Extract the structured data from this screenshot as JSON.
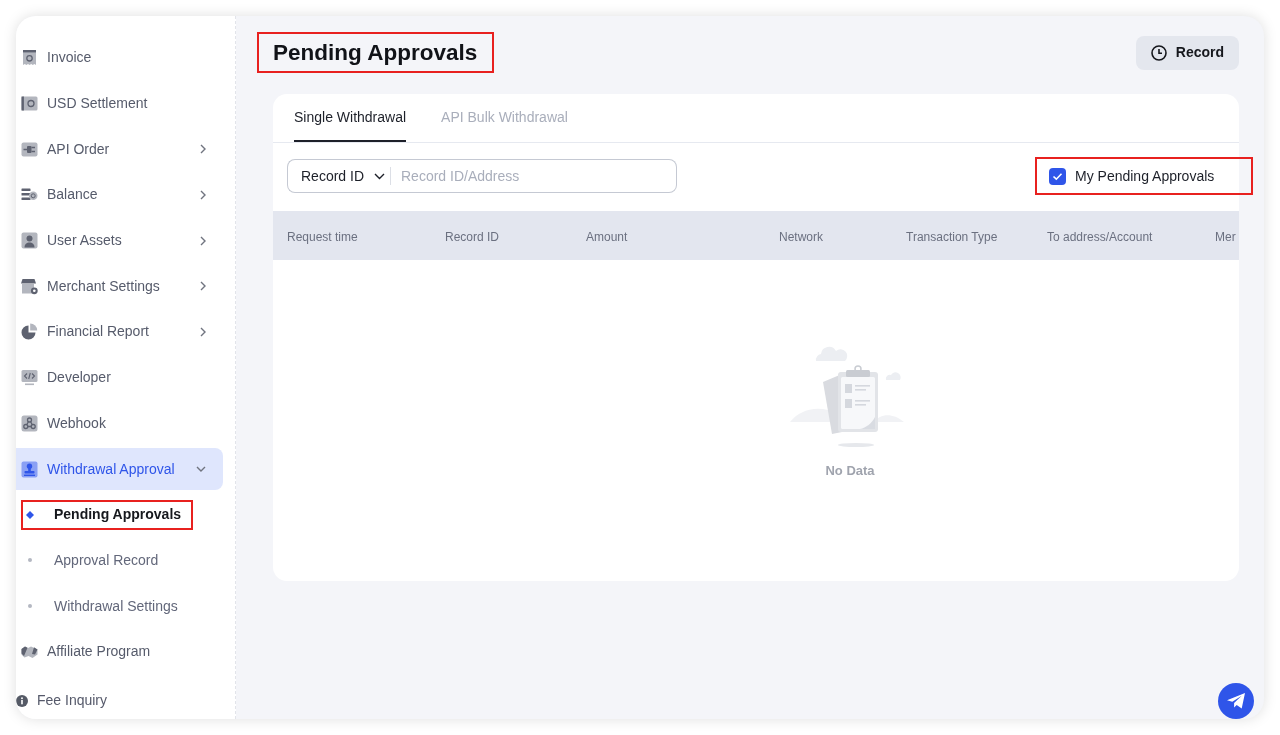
{
  "sidebar": {
    "items": [
      {
        "label": "Invoice",
        "kind": "link",
        "selected": false
      },
      {
        "label": "USD Settlement",
        "kind": "link",
        "selected": false
      },
      {
        "label": "API Order",
        "kind": "group",
        "expanded": false,
        "selected": false
      },
      {
        "label": "Balance",
        "kind": "group",
        "expanded": false,
        "selected": false
      },
      {
        "label": "User Assets",
        "kind": "group",
        "expanded": false,
        "selected": false
      },
      {
        "label": "Merchant Settings",
        "kind": "group",
        "expanded": false,
        "selected": false
      },
      {
        "label": "Financial Report",
        "kind": "group",
        "expanded": false,
        "selected": false
      },
      {
        "label": "Developer",
        "kind": "link",
        "selected": false
      },
      {
        "label": "Webhook",
        "kind": "link",
        "selected": false
      },
      {
        "label": "Withdrawal Approval",
        "kind": "group",
        "expanded": true,
        "selected": true,
        "children": [
          {
            "label": "Pending Approvals",
            "selected": true,
            "highlighted": true
          },
          {
            "label": "Approval Record",
            "selected": false,
            "highlighted": false
          },
          {
            "label": "Withdrawal Settings",
            "selected": false,
            "highlighted": false
          }
        ]
      },
      {
        "label": "Affiliate Program",
        "kind": "link",
        "selected": false
      }
    ],
    "footer_link": {
      "label": "Fee Inquiry"
    }
  },
  "header": {
    "title": {
      "text": "Pending Approvals",
      "highlighted": true
    },
    "record_button": "Record"
  },
  "card": {
    "tabs": [
      {
        "label": "Single Withdrawal",
        "selected": true
      },
      {
        "label": "API Bulk Withdrawal",
        "selected": false
      }
    ],
    "search": {
      "field_select": "Record ID",
      "placeholder": "Record ID/Address"
    },
    "my_pending_filter": {
      "label": "My Pending Approvals",
      "checked": true,
      "highlighted": true
    },
    "table": {
      "columns": [
        "Request time",
        "Record ID",
        "Amount",
        "Network",
        "Transaction Type",
        "To address/Account",
        "Mer"
      ]
    },
    "empty_state": {
      "message": "No Data"
    }
  }
}
